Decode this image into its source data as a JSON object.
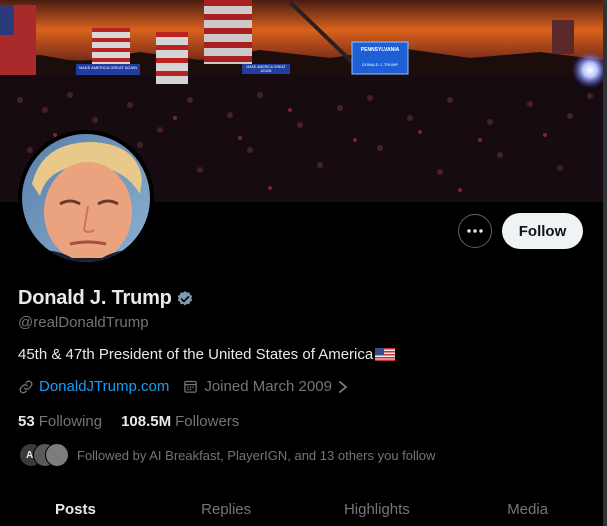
{
  "profile": {
    "display_name": "Donald J. Trump",
    "handle": "@realDonaldTrump",
    "bio": "45th & 47th President of the United States of America",
    "website": "DonaldJTrump.com",
    "joined": "Joined March 2009",
    "following_count": "53",
    "following_label": "Following",
    "followers_count": "108.5M",
    "followers_label": "Followers",
    "followed_by": "Followed by AI Breakfast, PlayerIGN, and 13 others you follow",
    "mini_avatar_text": "AI"
  },
  "banner": {
    "sign_text_1": "PENNSYLVANIA",
    "sign_text_2": "DONALD J. TRUMP",
    "banner_left": "MAKE AMERICA GREAT AGAIN",
    "banner_mid": "MAKE AMERICA GREAT AGAIN"
  },
  "actions": {
    "follow_label": "Follow"
  },
  "tabs": [
    {
      "label": "Posts",
      "active": true
    },
    {
      "label": "Replies",
      "active": false
    },
    {
      "label": "Highlights",
      "active": false
    },
    {
      "label": "Media",
      "active": false
    }
  ],
  "colors": {
    "accent": "#1d9bf0",
    "muted": "#71767b",
    "text": "#e7e9ea",
    "follow_bg": "#eff3f4"
  }
}
